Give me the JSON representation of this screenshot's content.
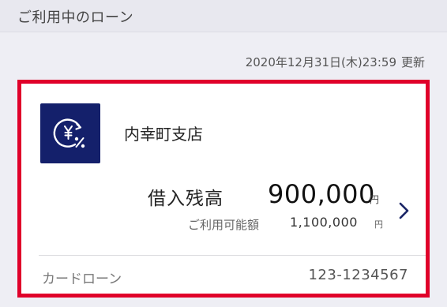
{
  "section": {
    "title": "ご利用中のローン"
  },
  "updated": {
    "datetime": "2020年12月31日(木)23:59",
    "label": "更新"
  },
  "loan_card": {
    "logo_icon": "yen-percent-icon",
    "branch": "内幸町支店",
    "balance_label": "借入残高",
    "balance_amount": "900,000",
    "balance_unit": "円",
    "available_label": "ご利用可能額",
    "available_amount": "1,100,000",
    "available_unit": "円",
    "detail_icon": "chevron-right-icon",
    "loan_type": "カードローン",
    "account_number": "123-1234567"
  },
  "colors": {
    "highlight_border": "#e0002a",
    "logo_background": "#14206b",
    "chevron": "#1a2566",
    "page_background": "#eeeef4"
  }
}
